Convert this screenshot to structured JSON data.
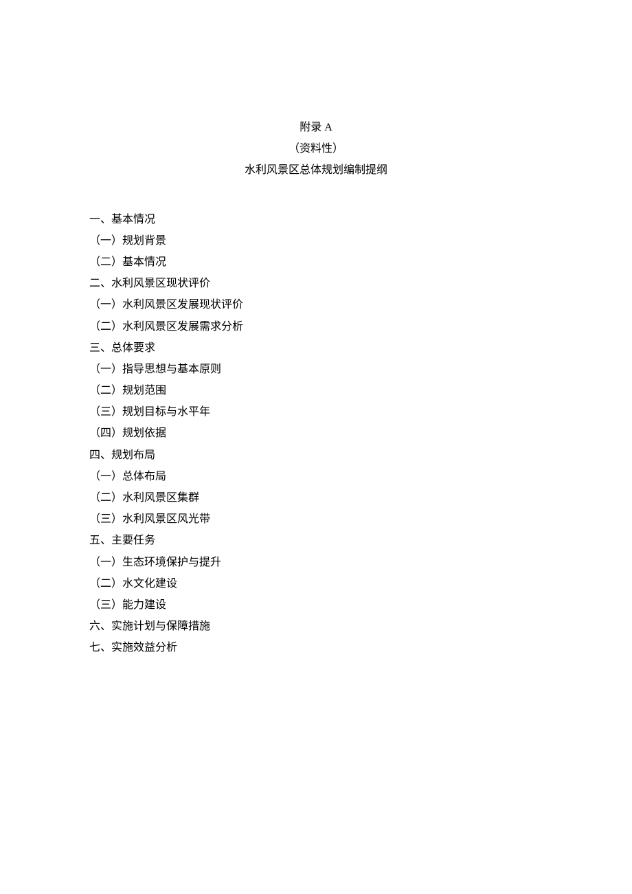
{
  "header": {
    "line1": "附录 A",
    "line2": "（资料性）",
    "line3": "水利风景区总体规划编制提纲"
  },
  "outline": [
    "一、基本情况",
    "（一）规划背景",
    "（二）基本情况",
    "二、水利风景区现状评价",
    "（一）水利风景区发展现状评价",
    "（二）水利风景区发展需求分析",
    "三、总体要求",
    "（一）指导思想与基本原则",
    "（二）规划范围",
    "（三）规划目标与水平年",
    "（四）规划依据",
    "四、规划布局",
    "（一）总体布局",
    "（二）水利风景区集群",
    "（三）水利风景区风光带",
    "五、主要任务",
    "（一）生态环境保护与提升",
    "（二）水文化建设",
    "（三）能力建设",
    "六、实施计划与保障措施",
    "七、实施效益分析"
  ]
}
